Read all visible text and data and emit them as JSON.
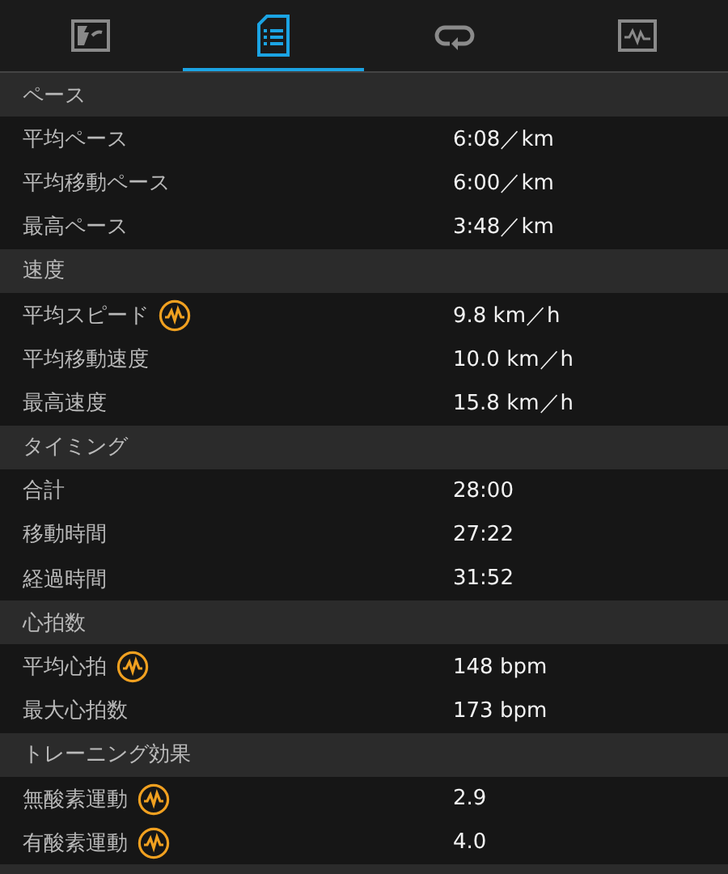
{
  "tabs": [
    {
      "selected": false
    },
    {
      "selected": true
    },
    {
      "selected": false
    },
    {
      "selected": false
    }
  ],
  "sections": [
    {
      "title": "ペース",
      "rows": [
        {
          "label": "平均ペース",
          "value": "6:08／km",
          "chart_icon": false
        },
        {
          "label": "平均移動ペース",
          "value": "6:00／km",
          "chart_icon": false
        },
        {
          "label": "最高ペース",
          "value": "3:48／km",
          "chart_icon": false
        }
      ]
    },
    {
      "title": "速度",
      "rows": [
        {
          "label": "平均スピード",
          "value": "9.8 km／h",
          "chart_icon": true
        },
        {
          "label": "平均移動速度",
          "value": "10.0 km／h",
          "chart_icon": false
        },
        {
          "label": "最高速度",
          "value": "15.8 km／h",
          "chart_icon": false
        }
      ]
    },
    {
      "title": "タイミング",
      "rows": [
        {
          "label": "合計",
          "value": "28:00",
          "chart_icon": false
        },
        {
          "label": "移動時間",
          "value": "27:22",
          "chart_icon": false
        },
        {
          "label": "経過時間",
          "value": "31:52",
          "chart_icon": false
        }
      ]
    },
    {
      "title": "心拍数",
      "rows": [
        {
          "label": "平均心拍",
          "value": "148 bpm",
          "chart_icon": true
        },
        {
          "label": "最大心拍数",
          "value": "173 bpm",
          "chart_icon": false
        }
      ]
    },
    {
      "title": "トレーニング効果",
      "rows": [
        {
          "label": "無酸素運動",
          "value": "2.9",
          "chart_icon": true
        },
        {
          "label": "有酸素運動",
          "value": "4.0",
          "chart_icon": true
        }
      ]
    }
  ]
}
